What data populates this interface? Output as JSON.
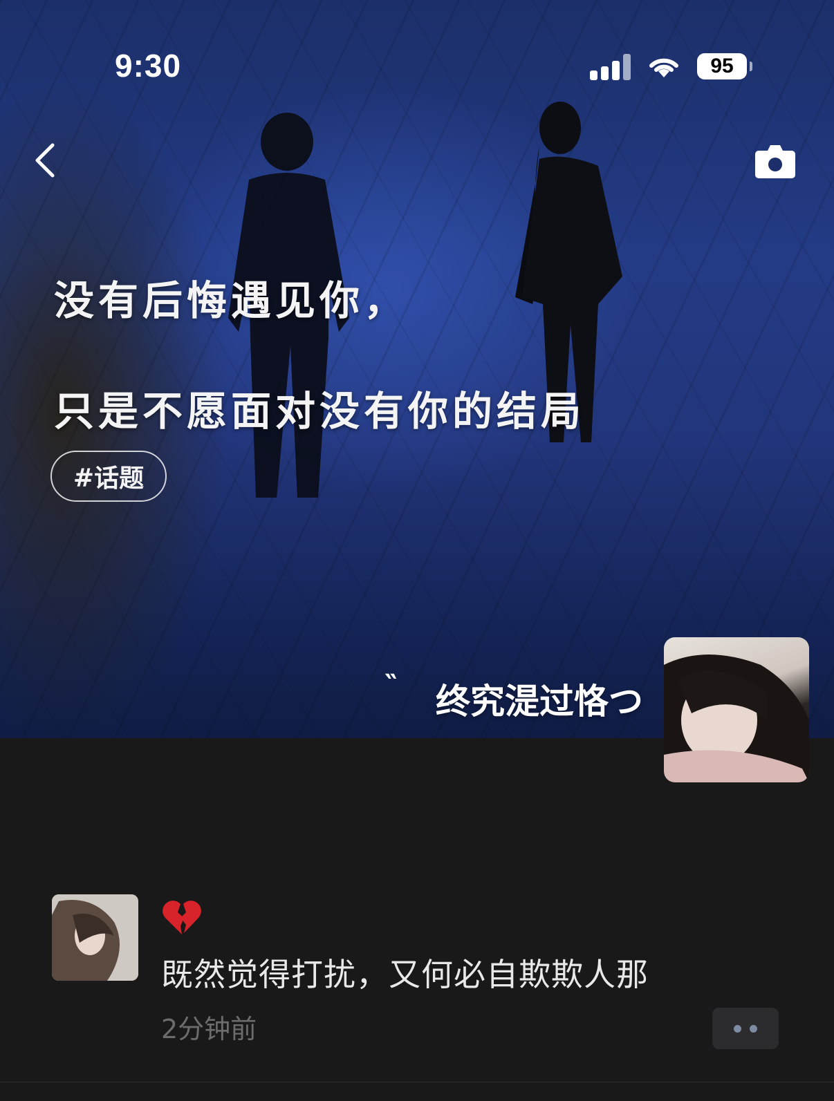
{
  "status_bar": {
    "time": "9:30",
    "battery": "95"
  },
  "cover": {
    "headline_line1": "没有后悔遇见你，",
    "headline_line2": "只是不愿面对没有你的结局",
    "topic_tag": "#话题",
    "quote_mark": "‶",
    "username": "终究湜过恪つ"
  },
  "post": {
    "emoji": "broken-heart-icon",
    "text": "既然觉得打扰，又何必自欺欺人那",
    "time": "2分钟前"
  },
  "colors": {
    "background": "#191919",
    "cover_blue": "#233b85",
    "post_text": "#e9e9e9",
    "timestamp": "#6c6c6c",
    "more_button_bg": "#2c2c2e"
  }
}
